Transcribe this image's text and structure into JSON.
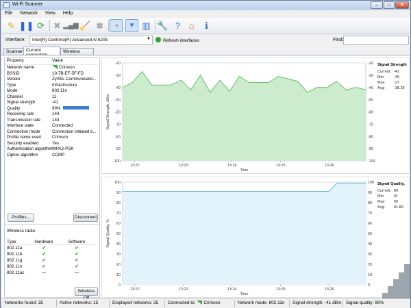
{
  "window": {
    "title": "Wi-Fi Scanner",
    "controls": [
      "–",
      "□",
      "✕"
    ]
  },
  "menu": [
    "File",
    "Network",
    "View",
    "Help"
  ],
  "toolbar": {
    "icons": [
      "connect-icon",
      "pause-icon",
      "refresh-icon",
      "disconnect-icon",
      "signal-bars-icon",
      "clean-icon",
      "grid-icon",
      "rss-filter-icon",
      "filter-icon",
      "columns-icon",
      "settings-icon",
      "help-icon",
      "home-icon",
      "info-icon"
    ],
    "glyphs": [
      "✎",
      "❚❚",
      "⟳",
      "✖",
      "▂▄▆",
      "🧹",
      "▦",
      "◔",
      "▼",
      "▥",
      "🔧",
      "?",
      "⌂",
      "ℹ"
    ],
    "colors": [
      "#e9a227",
      "#3366cc",
      "#3a9c3a",
      "#a8a8a8",
      "#777777",
      "#8a6a3a",
      "#8a8a8a",
      "#e06a16",
      "#3d7ed2",
      "#3d7ed2",
      "#4b73b8",
      "#2f6fc7",
      "#d8731f",
      "#2f6fc7"
    ]
  },
  "interface": {
    "label": "Interface:",
    "value": "Intel(R) Centrino(R) Advanced-N 6205",
    "refresh_label": "Refresh interfaces"
  },
  "find": {
    "label": "Find:",
    "value": ""
  },
  "tabs": [
    "Scanner",
    "Current connection",
    "Wireless statistics"
  ],
  "properties": {
    "headers": [
      "Property",
      "Value"
    ],
    "rows": [
      {
        "name": "Network name",
        "value": "Crimson"
      },
      {
        "name": "BSSID",
        "value": "10-7B-EF-5F-FD"
      },
      {
        "name": "Vendor",
        "value": "ZyXEL Communicatio..."
      },
      {
        "name": "Type",
        "value": "Infrastructure"
      },
      {
        "name": "Mode",
        "value": "802.11n"
      },
      {
        "name": "Channel",
        "value": "11"
      },
      {
        "name": "Signal strength",
        "value": "-41"
      },
      {
        "name": "Quality",
        "value": "99%"
      },
      {
        "name": "Receiving rate",
        "value": "144"
      },
      {
        "name": "Transmission rate",
        "value": "144"
      },
      {
        "name": "Interface state",
        "value": "Connected"
      },
      {
        "name": "Connection mode",
        "value": "Connection initiated b..."
      },
      {
        "name": "Profile name used",
        "value": "Crimson"
      },
      {
        "name": "Security enabled",
        "value": "Yes"
      },
      {
        "name": "Authentication algorithm",
        "value": "WPA2-PSK"
      },
      {
        "name": "Cipher algorithm",
        "value": "CCMP"
      }
    ],
    "quality_fraction": 0.99
  },
  "buttons": {
    "profiles": "Profiles...",
    "disconnect": "Disconnect",
    "wireless_off": "Wireless Off"
  },
  "radio": {
    "title": "Wireless radio",
    "headers": [
      "Type",
      "Hardware",
      "Software"
    ],
    "rows": [
      {
        "type": "802.11a",
        "hw": "✔",
        "sw": "✔"
      },
      {
        "type": "802.11b",
        "hw": "✔",
        "sw": "✔"
      },
      {
        "type": "802.11g",
        "hw": "✔",
        "sw": "✔"
      },
      {
        "type": "802.11n",
        "hw": "✔",
        "sw": "✔"
      },
      {
        "type": "802.11ac",
        "hw": "—",
        "sw": "—"
      }
    ]
  },
  "chart_data": [
    {
      "type": "area",
      "ylabel": "Signal Strength, dBm",
      "xlabel": "Time",
      "ylim": [
        -100,
        -20
      ],
      "yticks": [
        -20,
        -30,
        -40,
        -50,
        -60,
        -70,
        -80,
        -90,
        -100
      ],
      "xtick_labels": [
        "13:22",
        "13:23",
        "13:24",
        "13:25",
        "13:26"
      ],
      "color": "#58b858",
      "fill": "#cdeccd",
      "x": [
        0,
        4,
        8,
        12,
        16,
        20,
        24,
        28,
        32,
        36,
        40,
        44,
        48,
        52,
        56,
        60,
        64,
        68,
        72,
        76,
        80,
        84,
        88,
        92,
        96,
        100
      ],
      "values": [
        -40,
        -36,
        -27,
        -38,
        -38,
        -38,
        -34,
        -42,
        -30,
        -44,
        -34,
        -43,
        -31,
        -36,
        -36,
        -36,
        -31,
        -33,
        -35,
        -44,
        -40,
        -40,
        -35,
        -42,
        -40,
        -42
      ],
      "stats_title": "Signal Strength",
      "stats": [
        {
          "k": "Current:",
          "v": "-41"
        },
        {
          "k": "Min:",
          "v": "-49"
        },
        {
          "k": "Max:",
          "v": "-27"
        },
        {
          "k": "Avg:",
          "v": "-38.28"
        }
      ]
    },
    {
      "type": "area",
      "ylabel": "Signal Quality, %",
      "xlabel": "Time",
      "ylim": [
        0,
        100
      ],
      "yticks": [
        100,
        90,
        80,
        70,
        60,
        50,
        40,
        30,
        20,
        10,
        0
      ],
      "xtick_labels": [
        "13:22",
        "13:23",
        "13:24",
        "13:25",
        "13:26"
      ],
      "color": "#48b8d8",
      "fill": "#e2f3fb",
      "x": [
        0,
        10,
        20,
        30,
        40,
        50,
        60,
        70,
        80,
        85,
        88,
        92,
        100
      ],
      "values": [
        91,
        91,
        91,
        91,
        91,
        91,
        91,
        91,
        91,
        91,
        99,
        99,
        99
      ],
      "stats_title": "Signal Quality,",
      "stats": [
        {
          "k": "Current:",
          "v": "99"
        },
        {
          "k": "Min:",
          "v": "91"
        },
        {
          "k": "Max:",
          "v": "99"
        },
        {
          "k": "Avg:",
          "v": "91.89"
        }
      ]
    }
  ],
  "status": {
    "networks_found": "Networks found: 35",
    "active": "Active networks: 15",
    "displayed": "Displayed networks: 35",
    "connected_label": "Connected to:",
    "connected_value": "Crimson",
    "mode": "Network mode: 802.11n",
    "strength": "Signal strength: -41 dBm",
    "quality": "Signal quality: 99%"
  }
}
